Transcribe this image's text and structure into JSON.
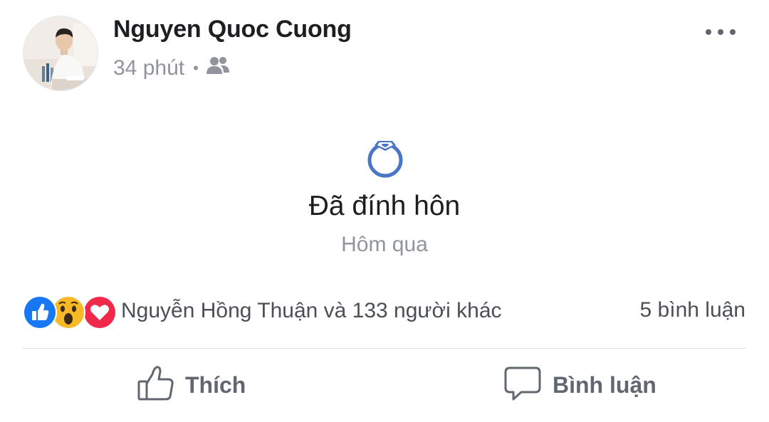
{
  "post": {
    "author": {
      "name": "Nguyen Quoc Cuong"
    },
    "timestamp": "34 phút",
    "separator": "•",
    "audience_icon": "friends-icon",
    "more_icon": "more-horizontal-icon"
  },
  "life_event": {
    "icon": "engagement-ring-icon",
    "title": "Đã đính hôn",
    "date": "Hôm qua"
  },
  "reactions": {
    "icons": [
      "like-reaction-icon",
      "wow-reaction-icon",
      "love-reaction-icon"
    ],
    "summary": "Nguyễn Hồng Thuận và 133 người khác",
    "comment_count": "5 bình luận"
  },
  "actions": {
    "like_label": "Thích",
    "comment_label": "Bình luận"
  },
  "colors": {
    "like_blue": "#1877f2",
    "wow_yellow": "#f7b928",
    "love_red": "#f0284a",
    "ring_blue": "#4a76c8",
    "secondary_text": "#90949c"
  }
}
